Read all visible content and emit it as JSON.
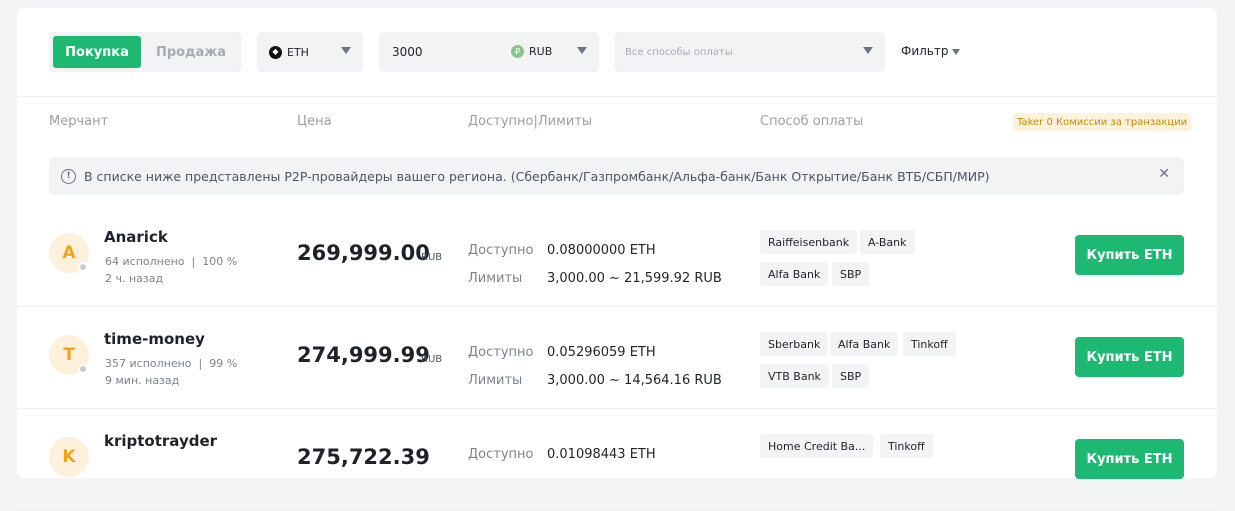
{
  "controls": {
    "buy_label": "Покупка",
    "sell_label": "Продажа",
    "coin": "ETH",
    "amount": "3000",
    "fiat": "RUB",
    "payment_placeholder": "Все способы оплаты",
    "filter_label": "Фильтр"
  },
  "table_header": {
    "merchant": "Мерчант",
    "price": "Цена",
    "available_limits": "Доступно|Лимиты",
    "payment": "Способ оплаты",
    "taker_badge": "Taker 0 Комиссии за транзакции"
  },
  "notice": {
    "text": "В списке ниже представлены P2P-провайдеры вашего региона. (Сбербанк/Газпромбанк/Альфа-банк/Банк Открытие/Банк ВТБ/СБП/МИР)"
  },
  "labels": {
    "available": "Доступно",
    "limits": "Лимиты",
    "currency": "RUB"
  },
  "rows": [
    {
      "initial": "A",
      "name": "Anarick",
      "stats": "64 исполнено  |  100 %",
      "time": "2 ч. назад",
      "price": "269,999.00",
      "available": "0.08000000 ETH",
      "limits": "3,000.00 ~ 21,599.92 RUB",
      "payments": [
        "Raiffeisenbank",
        "A-Bank",
        "Alfa Bank",
        "SBP"
      ],
      "button": "Купить ETH"
    },
    {
      "initial": "T",
      "name": "time-money",
      "stats": "357 исполнено  |  99 %",
      "time": "9 мин. назад",
      "price": "274,999.99",
      "available": "0.05296059 ETH",
      "limits": "3,000.00 ~ 14,564.16 RUB",
      "payments": [
        "Sberbank",
        "Alfa Bank",
        "Tinkoff",
        "VTB Bank",
        "SBP"
      ],
      "button": "Купить ETH"
    },
    {
      "initial": "K",
      "name": "kriptotrayder",
      "price": "275,722.39",
      "available": "0.01098443 ETH",
      "payments": [
        "Home Credit Ba...",
        "Tinkoff"
      ],
      "button": "Купить ETH"
    }
  ],
  "colors": {
    "accent": "#1db872",
    "badge_bg": "#fdf3dc",
    "badge_text": "#c88a0b"
  }
}
